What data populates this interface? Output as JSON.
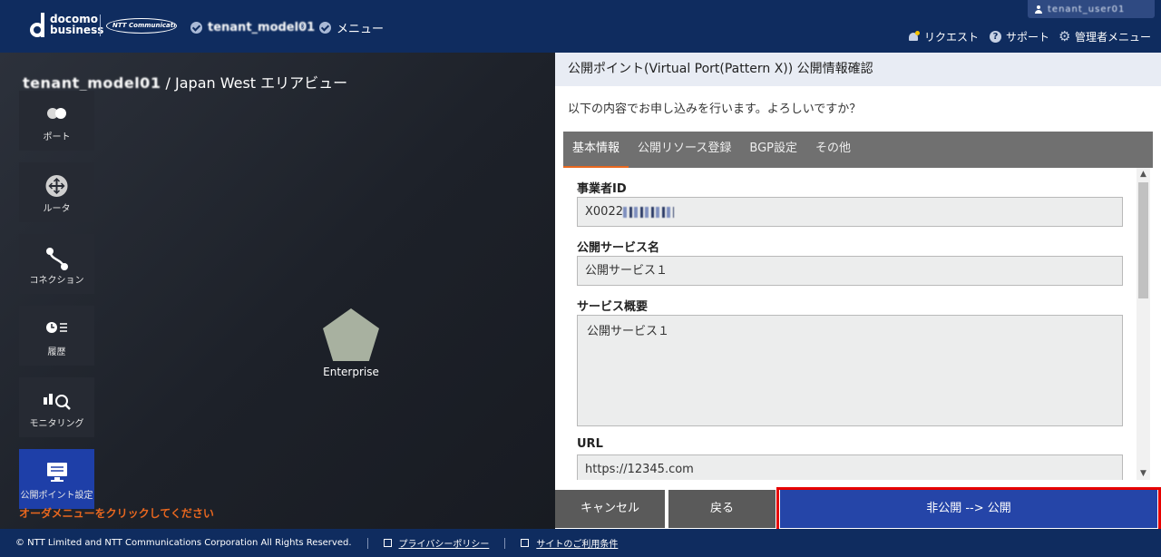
{
  "header": {
    "logo": {
      "line1": "docomo",
      "line2": "business",
      "partner": "NTT Communications"
    },
    "breadcrumb": {
      "tenant": "tenant_model01",
      "menu": "メニュー"
    },
    "user_name": "tenant_user01",
    "nav": {
      "request": "リクエスト",
      "support": "サポート",
      "admin_menu": "管理者メニュー"
    }
  },
  "area": {
    "tenant": "tenant_model01",
    "title_suffix": " / Japan West エリアビュー"
  },
  "toolbar": [
    {
      "label": "ポート",
      "icon": "port-icon"
    },
    {
      "label": "ルータ",
      "icon": "router-icon"
    },
    {
      "label": "コネクション",
      "icon": "connection-icon"
    },
    {
      "label": "履歴",
      "icon": "history-icon"
    },
    {
      "label": "モニタリング",
      "icon": "monitoring-icon"
    },
    {
      "label": "公開ポイント設定",
      "icon": "public-point-icon",
      "active": true
    }
  ],
  "canvas": {
    "node_label": "Enterprise"
  },
  "hint": "オーダメニューをクリックしてください",
  "panel": {
    "title": "公開ポイント(Virtual Port(Pattern X)) 公開情報確認",
    "message": "以下の内容でお申し込みを行います。よろしいですか？",
    "tabs": [
      "基本情報",
      "公開リソース登録",
      "BGP設定",
      "その他"
    ],
    "active_tab": 0,
    "fields": {
      "business_id_label": "事業者ID",
      "business_id_value": "X0022",
      "service_name_label": "公開サービス名",
      "service_name_value": "公開サービス１",
      "overview_label": "サービス概要",
      "overview_value": "公開サービス１",
      "url_label": "URL",
      "url_value": "https://12345.com"
    }
  },
  "buttons": {
    "cancel": "キャンセル",
    "back": "戻る",
    "publish": "非公開 --> 公開"
  },
  "footer": {
    "copyright": "© NTT Limited and NTT Communications Corporation All Rights Reserved.",
    "privacy": "プライバシーポリシー",
    "terms": "サイトのご利用条件"
  },
  "colors": {
    "header_bg": "#0f2c5f",
    "accent": "#e8671f",
    "primary_button": "#2545a8",
    "highlight": "#e60000"
  }
}
